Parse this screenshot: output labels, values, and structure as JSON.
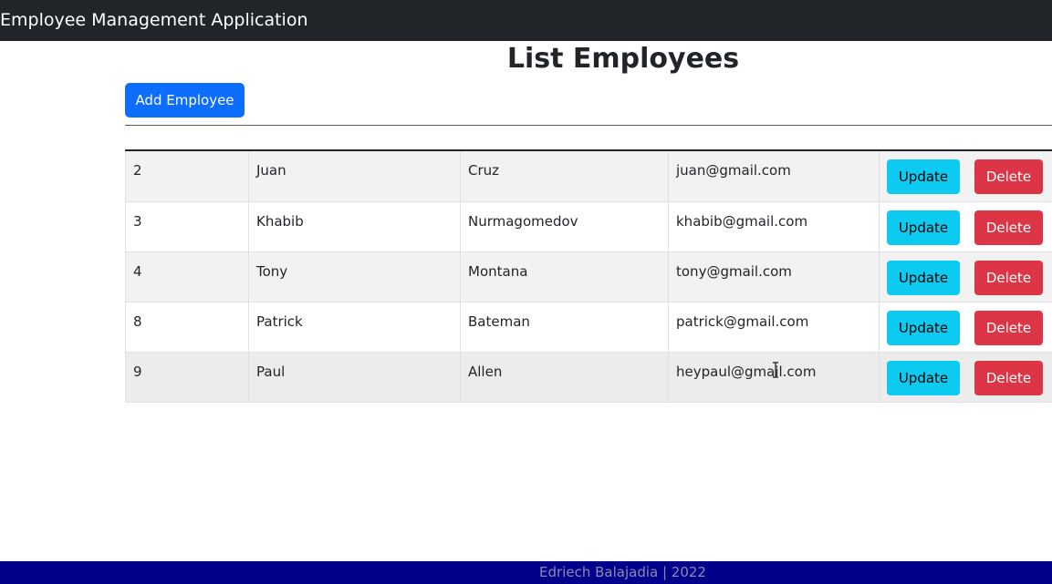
{
  "navbar": {
    "brand": "Employee Management Application"
  },
  "main": {
    "title": "List Employees",
    "add_button_label": "Add Employee"
  },
  "table": {
    "rows": [
      {
        "id": "2",
        "first_name": "Juan",
        "last_name": "Cruz",
        "email": "juan@gmail.com",
        "update_label": "Update",
        "delete_label": "Delete"
      },
      {
        "id": "3",
        "first_name": "Khabib",
        "last_name": "Nurmagomedov",
        "email": "khabib@gmail.com",
        "update_label": "Update",
        "delete_label": "Delete"
      },
      {
        "id": "4",
        "first_name": "Tony",
        "last_name": "Montana",
        "email": "tony@gmail.com",
        "update_label": "Update",
        "delete_label": "Delete"
      },
      {
        "id": "8",
        "first_name": "Patrick",
        "last_name": "Bateman",
        "email": "patrick@gmail.com",
        "update_label": "Update",
        "delete_label": "Delete"
      },
      {
        "id": "9",
        "first_name": "Paul",
        "last_name": "Allen",
        "email": "heypaul@gmail.com",
        "update_label": "Update",
        "delete_label": "Delete"
      }
    ]
  },
  "footer": {
    "text": "Edriech Balajadia | 2022"
  },
  "colors": {
    "navbar_bg": "#212529",
    "primary": "#0d6efd",
    "info": "#0dcaf0",
    "danger": "#dc3545",
    "footer_bg": "#00008b"
  },
  "icons": {
    "cursor": "text-cursor-icon"
  }
}
